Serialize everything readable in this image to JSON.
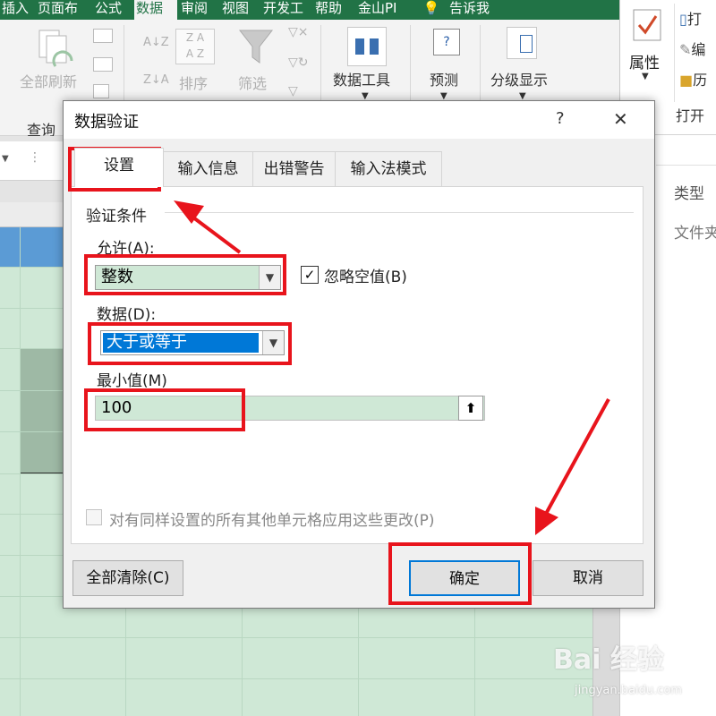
{
  "ribbon": {
    "tabs": [
      "插入",
      "页面布",
      "公式",
      "数据",
      "审阅",
      "视图",
      "开发工",
      "帮助",
      "金山PI",
      "告诉我"
    ],
    "active_tab": "数据",
    "groups": {
      "refresh_all": "全部刷新",
      "query": "查询",
      "sort": "排序",
      "filter": "筛选",
      "data_tools": "数据工具",
      "forecast": "预测",
      "outline": "分级显示"
    }
  },
  "right_pane": {
    "properties": "属性",
    "open": "打开",
    "item_open": "打",
    "item_edit": "编",
    "item_history": "历",
    "type_label": "类型",
    "folder_label": "文件夹"
  },
  "dialog": {
    "title": "数据验证",
    "help": "?",
    "close": "✕",
    "tabs": [
      "设置",
      "输入信息",
      "出错警告",
      "输入法模式"
    ],
    "selected_tab": "设置",
    "section": "验证条件",
    "allow_label": "允许(A):",
    "allow_value": "整数",
    "ignore_blank_label": "忽略空值(B)",
    "ignore_blank_checked": true,
    "data_label": "数据(D):",
    "data_value": "大于或等于",
    "min_label": "最小值(M)",
    "min_value": "100",
    "apply_all_label": "对有同样设置的所有其他单元格应用这些更改(P)",
    "apply_all_checked": false,
    "clear_all": "全部清除(C)",
    "ok": "确定",
    "cancel": "取消"
  },
  "watermark": {
    "brand": "Bai 经验",
    "url": "jingyan.baidu.com"
  },
  "colors": {
    "excel_green": "#217346",
    "annotation_red": "#e8141c",
    "selection_blue": "#0078d7",
    "cell_green": "#cfe8d6"
  }
}
